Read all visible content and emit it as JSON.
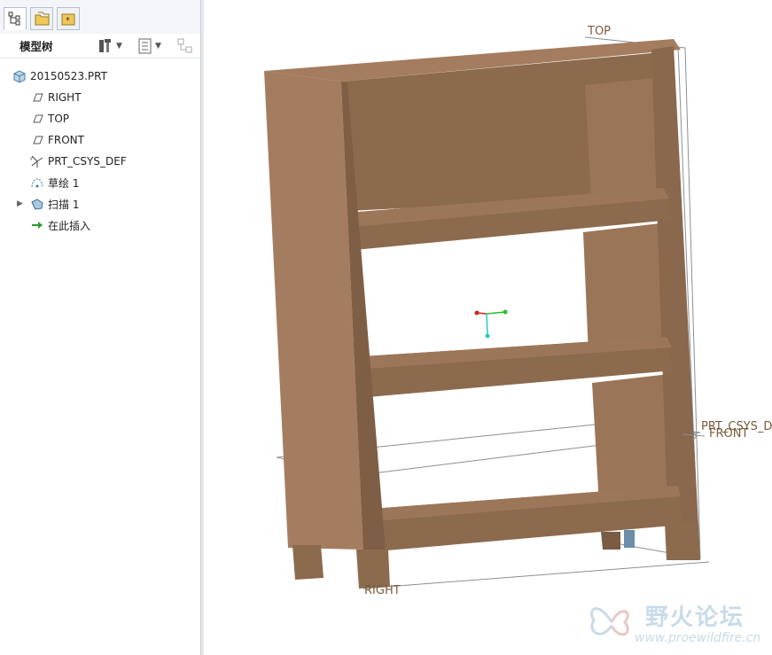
{
  "tabs": [
    {
      "name": "model-tree-tab"
    },
    {
      "name": "folder-browser-tab"
    },
    {
      "name": "favorites-tab"
    }
  ],
  "panel": {
    "title": "模型树"
  },
  "tree": {
    "items": [
      {
        "label": "20150523.PRT",
        "icon": "part-icon"
      },
      {
        "label": "RIGHT",
        "icon": "datum-plane-icon"
      },
      {
        "label": "TOP",
        "icon": "datum-plane-icon"
      },
      {
        "label": "FRONT",
        "icon": "datum-plane-icon"
      },
      {
        "label": "PRT_CSYS_DEF",
        "icon": "coordinate-system-icon"
      },
      {
        "label": "草绘 1",
        "icon": "sketch-icon"
      },
      {
        "label": "扫描 1",
        "icon": "sweep-icon"
      },
      {
        "label": "在此插入",
        "icon": "insert-here-arrow-icon"
      }
    ]
  },
  "viewport": {
    "datum_labels": {
      "top": "TOP",
      "right": "RIGHT",
      "front": "FRONT",
      "csys": "PRT_CSYS_DEF"
    }
  },
  "watermark": {
    "title": "野火论坛",
    "url": "www.proewildfire.cn"
  },
  "colors": {
    "wood_light": "#a47c5f",
    "wood_mid": "#8c6a4e",
    "wood_dark": "#76573f",
    "datum_line": "#8a8f96",
    "datum_text": "#7a5a3a"
  }
}
